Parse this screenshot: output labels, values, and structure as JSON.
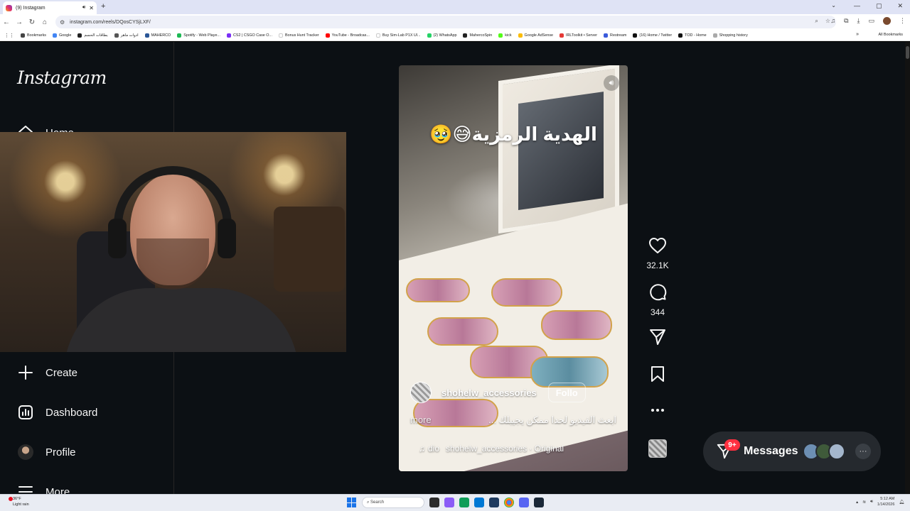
{
  "browser": {
    "tab_title": "(9) Instagram",
    "tab_audio_icon": "speaker-icon",
    "new_tab_label": "+",
    "url": "instagram.com/reels/DQosCYSjLXF/",
    "bookmarks": [
      {
        "label": "Bookmarks",
        "color": "#444444"
      },
      {
        "label": "Google",
        "color": "#4285f4"
      },
      {
        "label": "بطاقات الحسم",
        "color": "#222222"
      },
      {
        "label": "ادوات ماهر",
        "color": "#555555"
      },
      {
        "label": "MAHERCO",
        "color": "#2b5797"
      },
      {
        "label": "Spotify - Web Playe...",
        "color": "#1db954"
      },
      {
        "label": "CS2 | CSGO Case O...",
        "color": "#7b2ff7"
      },
      {
        "label": "Bonus Hunt Tracker",
        "color": "#ffffff"
      },
      {
        "label": "YouTube - Broadcas...",
        "color": "#ff0000"
      },
      {
        "label": "Buy Sim-Lab P1X Ul...",
        "color": "#ffffff"
      },
      {
        "label": "(2) WhatsApp",
        "color": "#25d366"
      },
      {
        "label": "MahercoSpin",
        "color": "#222222"
      },
      {
        "label": "kick",
        "color": "#53fc18"
      },
      {
        "label": "Google AdSense",
        "color": "#fbbc04"
      },
      {
        "label": "IRLToolkit • Server",
        "color": "#e53935"
      },
      {
        "label": "Restream",
        "color": "#3b5bdb"
      },
      {
        "label": "(16) Home / Twitter",
        "color": "#111111"
      },
      {
        "label": "TOD - Home",
        "color": "#111111"
      },
      {
        "label": "Shopping history",
        "color": "#aaaaaa"
      }
    ],
    "all_bookmarks_label": "All Bookmarks"
  },
  "sidebar": {
    "logo": "Instagram",
    "items": [
      {
        "label": "Home",
        "icon": "home-icon"
      },
      {
        "label": "Create",
        "icon": "plus-icon"
      },
      {
        "label": "Dashboard",
        "icon": "dashboard-icon"
      },
      {
        "label": "Profile",
        "icon": "profile-avatar"
      },
      {
        "label": "More",
        "icon": "hamburger-icon"
      }
    ]
  },
  "reel": {
    "overlay_text": "الهدية الرمزية😅🥹",
    "username": "shohelw_accessories",
    "follow_label": "Follo",
    "description": "ابعث الفيديو لحدا ممكن يجيبلك ...",
    "more_label": "more",
    "audio_tag": "dio",
    "audio_label": "shohelw_accessories · Original",
    "mute_icon": "speaker-icon"
  },
  "actions": {
    "likes": "32.1K",
    "comments": "344"
  },
  "messages": {
    "label": "Messages",
    "badge": "9+",
    "avatar_colors": [
      "#6d8fb3",
      "#3f5a3a",
      "#a4b6cc"
    ],
    "more_label": "···"
  },
  "taskbar": {
    "weather_temp": "36°F",
    "weather_desc": "Light rain",
    "weather_badge": "1",
    "search_placeholder": "Search",
    "time": "5:12 AM",
    "date": "1/14/2026"
  }
}
